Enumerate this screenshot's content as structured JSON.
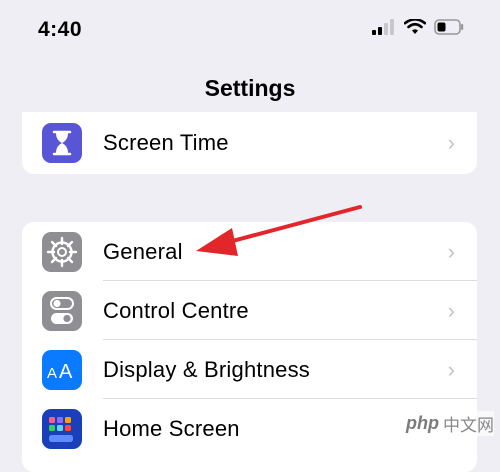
{
  "status_bar": {
    "time": "4:40"
  },
  "header": {
    "title": "Settings"
  },
  "groups": [
    {
      "items": [
        {
          "label": "Screen Time",
          "icon": "hourglass-icon",
          "color": "#5856d6"
        }
      ]
    },
    {
      "items": [
        {
          "label": "General",
          "icon": "gear-icon",
          "color": "#8e8e93"
        },
        {
          "label": "Control Centre",
          "icon": "toggles-icon",
          "color": "#8e8e93"
        },
        {
          "label": "Display & Brightness",
          "icon": "text-size-icon",
          "color": "#0a7aff"
        },
        {
          "label": "Home Screen",
          "icon": "app-grid-icon",
          "color": "#1a3fb8"
        }
      ]
    }
  ],
  "annotation": {
    "arrow_color": "#e3262a"
  },
  "watermark": {
    "logo": "php",
    "text": "中文网"
  }
}
